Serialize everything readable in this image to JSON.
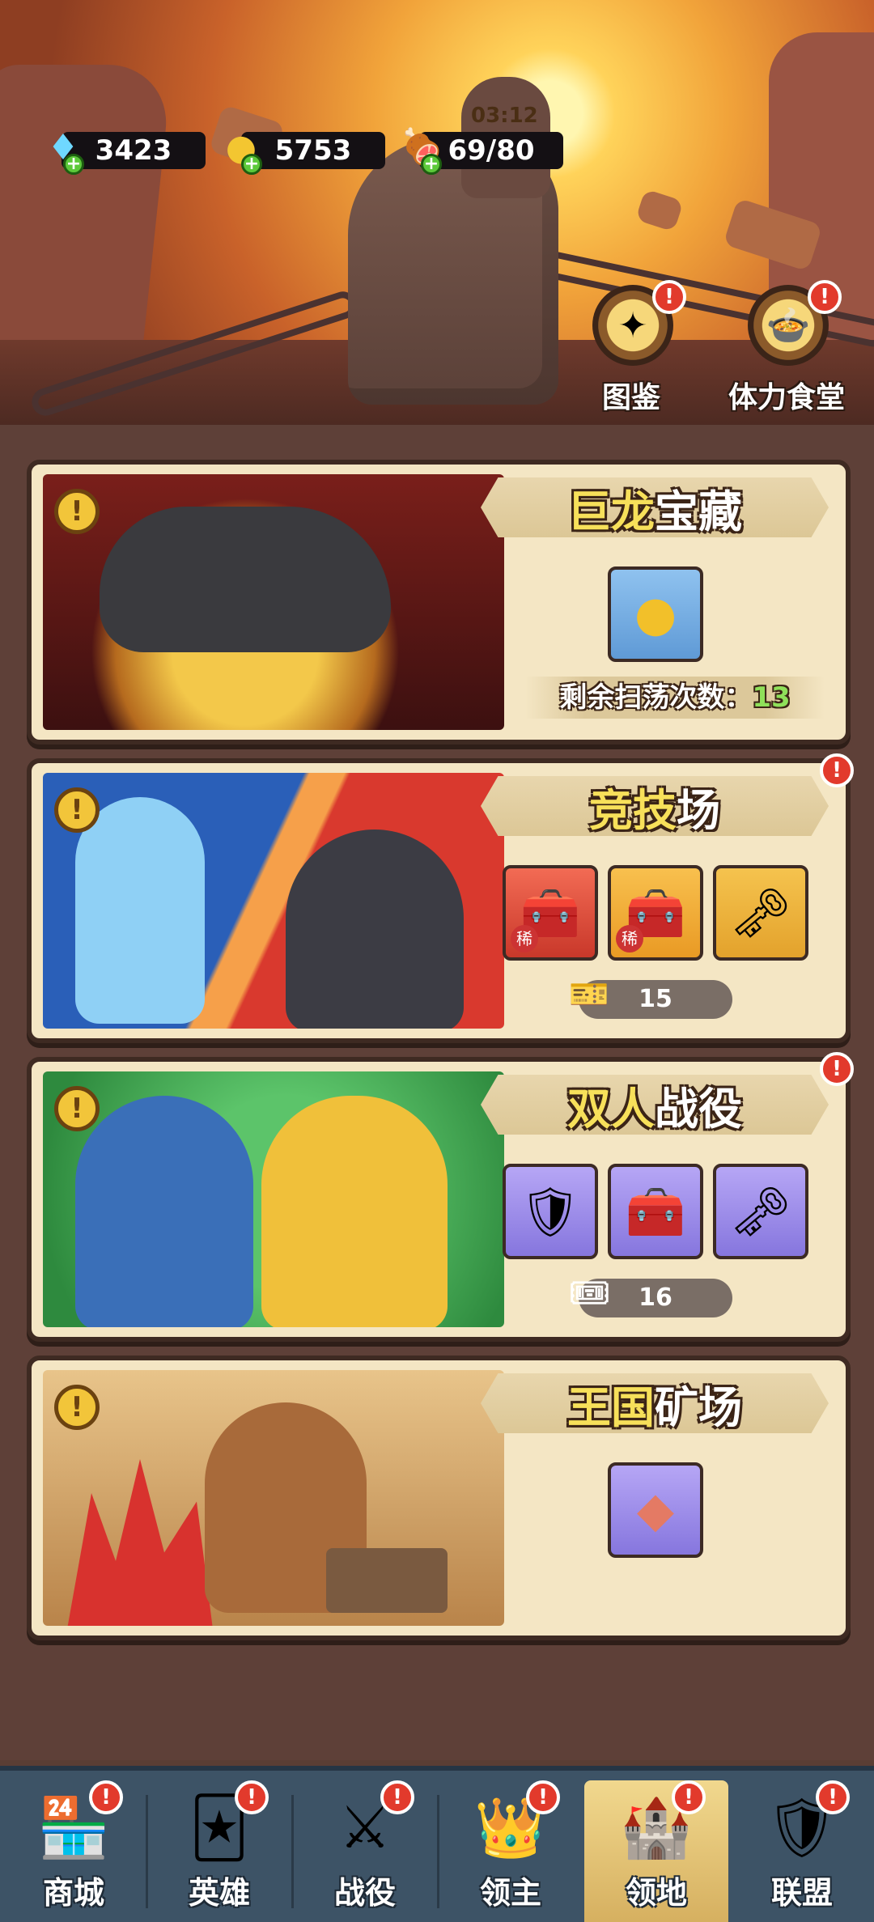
{
  "resources": {
    "gems": "3423",
    "gold": "5753",
    "stamina": "69/80",
    "stamina_timer": "03:12"
  },
  "header_buttons": {
    "codex": "图鉴",
    "canteen": "体力食堂"
  },
  "cards": [
    {
      "title_main": "巨龙",
      "title_rest": "宝藏",
      "sweep_label": "剩余扫荡次数：",
      "sweep_count": "13",
      "reward_icons": [
        "gold-coin-icon"
      ]
    },
    {
      "title_main": "竞技",
      "title_rest": "场",
      "ticket_count": "15",
      "reward_badge": "稀",
      "reward_icons": [
        "rare-chest-icon",
        "rare-chest-icon",
        "key-icon"
      ]
    },
    {
      "title_main": "双人",
      "title_rest": "战役",
      "ticket_count": "16",
      "reward_icons": [
        "mystery-armor-icon",
        "chest-icon",
        "key-icon"
      ]
    },
    {
      "title_main": "王国",
      "title_rest": "矿场",
      "reward_icons": [
        "crystal-icon"
      ]
    }
  ],
  "nav": [
    {
      "label": "商城",
      "icon": "shop-icon"
    },
    {
      "label": "英雄",
      "icon": "hero-cards-icon"
    },
    {
      "label": "战役",
      "icon": "crossed-swords-icon"
    },
    {
      "label": "领主",
      "icon": "lord-icon"
    },
    {
      "label": "领地",
      "icon": "castle-icon",
      "active": true
    },
    {
      "label": "联盟",
      "icon": "alliance-knight-icon"
    }
  ],
  "colors": {
    "alert": "#e23a2c",
    "nav_bg": "#3d5366",
    "nav_active": "#d6b060",
    "card_bg": "#f4e6c4"
  }
}
